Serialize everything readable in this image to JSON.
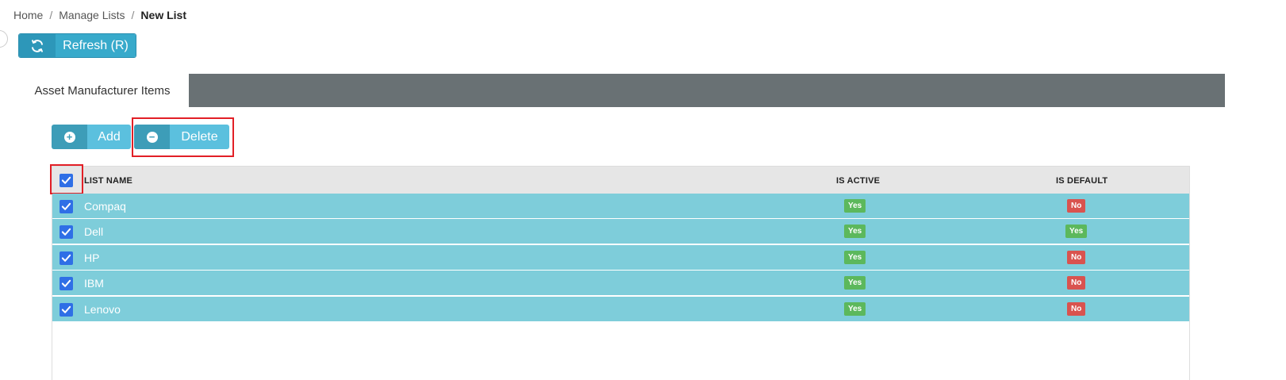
{
  "breadcrumb": {
    "home": "Home",
    "manage": "Manage Lists",
    "current": "New List",
    "separator": "/"
  },
  "toolbar": {
    "refresh_label": "Refresh (R)"
  },
  "tabs": [
    {
      "label": "Asset Manufacturer Items"
    }
  ],
  "actions": {
    "add_label": "Add",
    "delete_label": "Delete"
  },
  "table": {
    "headers": {
      "list_name": "LIST NAME",
      "is_active": "IS ACTIVE",
      "is_default": "IS DEFAULT"
    },
    "select_all_checked": true,
    "rows": [
      {
        "name": "Compaq",
        "is_active": "Yes",
        "is_default": "No",
        "checked": true
      },
      {
        "name": "Dell",
        "is_active": "Yes",
        "is_default": "Yes",
        "checked": true
      },
      {
        "name": "HP",
        "is_active": "Yes",
        "is_default": "No",
        "checked": true
      },
      {
        "name": "IBM",
        "is_active": "Yes",
        "is_default": "No",
        "checked": true
      },
      {
        "name": "Lenovo",
        "is_active": "Yes",
        "is_default": "No",
        "checked": true
      }
    ]
  },
  "colors": {
    "accent": "#38aacb",
    "row_selected": "#7ecdda",
    "badge_yes": "#5cb85c",
    "badge_no": "#d9534f",
    "highlight": "#e21f26",
    "tabbar": "#697174"
  },
  "icons": {
    "refresh": "refresh-icon",
    "add": "plus-circle-icon",
    "delete": "minus-circle-icon",
    "checkbox": "check-icon"
  }
}
